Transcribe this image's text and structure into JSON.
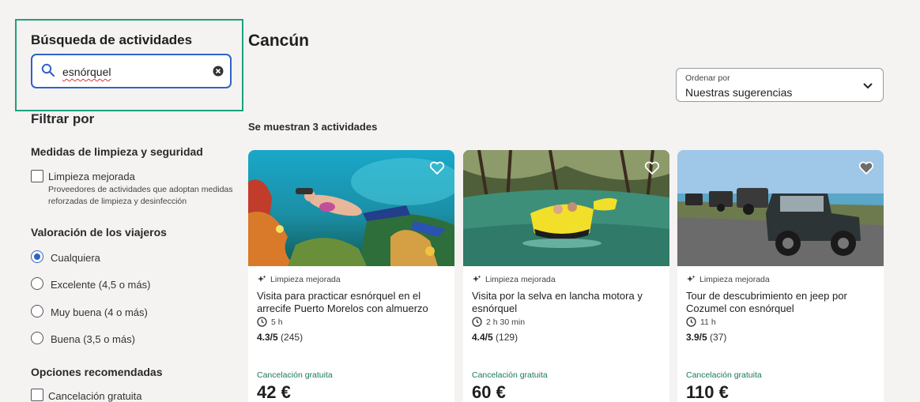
{
  "search": {
    "title": "Búsqueda de actividades",
    "value": "esnórquel"
  },
  "filters": {
    "title": "Filtrar por",
    "cleaning": {
      "heading": "Medidas de limpieza y seguridad",
      "option": "Limpieza mejorada",
      "description": "Proveedores de actividades que adoptan medidas reforzadas de limpieza y desinfección"
    },
    "rating": {
      "heading": "Valoración de los viajeros",
      "options": [
        "Cualquiera",
        "Excelente (4,5 o más)",
        "Muy buena (4 o más)",
        "Buena (3,5 o más)"
      ],
      "selected": "Cualquiera"
    },
    "recommended": {
      "heading": "Opciones recomendadas",
      "option": "Cancelación gratuita"
    }
  },
  "main": {
    "title": "Cancún",
    "sort": {
      "label": "Ordenar por",
      "value": "Nuestras sugerencias"
    },
    "result_count": "Se muestran 3 actividades",
    "cards": [
      {
        "badge": "Limpieza mejorada",
        "title": "Visita para practicar esnórquel en el arrecife Puerto Morelos con almuerzo",
        "duration": "5 h",
        "rating": "4.3/5",
        "reviews": "(245)",
        "cancel": "Cancelación gratuita",
        "price": "42 €",
        "favorite": false
      },
      {
        "badge": "Limpieza mejorada",
        "title": "Visita por la selva en lancha motora y esnórquel",
        "duration": "2 h 30 min",
        "rating": "4.4/5",
        "reviews": "(129)",
        "cancel": "Cancelación gratuita",
        "price": "60 €",
        "favorite": false
      },
      {
        "badge": "Limpieza mejorada",
        "title": "Tour de descubrimiento en jeep por Cozumel con esnórquel",
        "duration": "11 h",
        "rating": "3.9/5",
        "reviews": "(37)",
        "cancel": "Cancelación gratuita",
        "price": "110 €",
        "favorite": true
      }
    ]
  },
  "colors": {
    "accent": "#2f63c7",
    "highlight": "#1aa37d",
    "background": "#f5f2f2"
  }
}
